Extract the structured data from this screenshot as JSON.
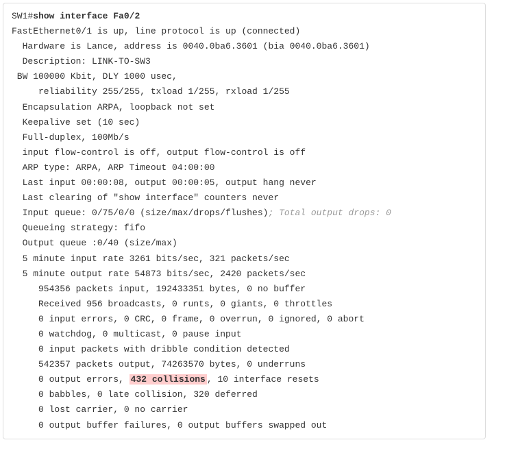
{
  "prompt": "SW1#",
  "command": "show interface Fa0/2",
  "lines": {
    "l01": "FastEthernet0/1 is up, line protocol is up (connected)",
    "l02": "  Hardware is Lance, address is 0040.0ba6.3601 (bia 0040.0ba6.3601)",
    "l03": "  Description: LINK-TO-SW3",
    "l04": " BW 100000 Kbit, DLY 1000 usec,",
    "l05": "     reliability 255/255, txload 1/255, rxload 1/255",
    "l06": "  Encapsulation ARPA, loopback not set",
    "l07": "  Keepalive set (10 sec)",
    "l08": "  Full-duplex, 100Mb/s",
    "l09": "  input flow-control is off, output flow-control is off",
    "l10": "  ARP type: ARPA, ARP Timeout 04:00:00",
    "l11": "  Last input 00:00:08, output 00:00:05, output hang never",
    "l12": "  Last clearing of \"show interface\" counters never",
    "l13_a": "  Input queue: 0/75/0/0 (size/max/drops/flushes)",
    "l13_b": "; Total output drops: 0",
    "l14": "  Queueing strategy: fifo",
    "l15": "  Output queue :0/40 (size/max)",
    "l16": "  5 minute input rate 3261 bits/sec, 321 packets/sec",
    "l17": "  5 minute output rate 54873 bits/sec, 2420 packets/sec",
    "l18": "     954356 packets input, 192433351 bytes, 0 no buffer",
    "l19": "     Received 956 broadcasts, 0 runts, 0 giants, 0 throttles",
    "l20": "     0 input errors, 0 CRC, 0 frame, 0 overrun, 0 ignored, 0 abort",
    "l21": "     0 watchdog, 0 multicast, 0 pause input",
    "l22": "     0 input packets with dribble condition detected",
    "l23": "     542357 packets output, 74263570 bytes, 0 underruns",
    "l24_a": "     0 output errors, ",
    "l24_b": "432 collisions",
    "l24_c": ", 10 interface resets",
    "l25": "     0 babbles, 0 late collision, 320 deferred",
    "l26": "     0 lost carrier, 0 no carrier",
    "l27": "     0 output buffer failures, 0 output buffers swapped out"
  }
}
